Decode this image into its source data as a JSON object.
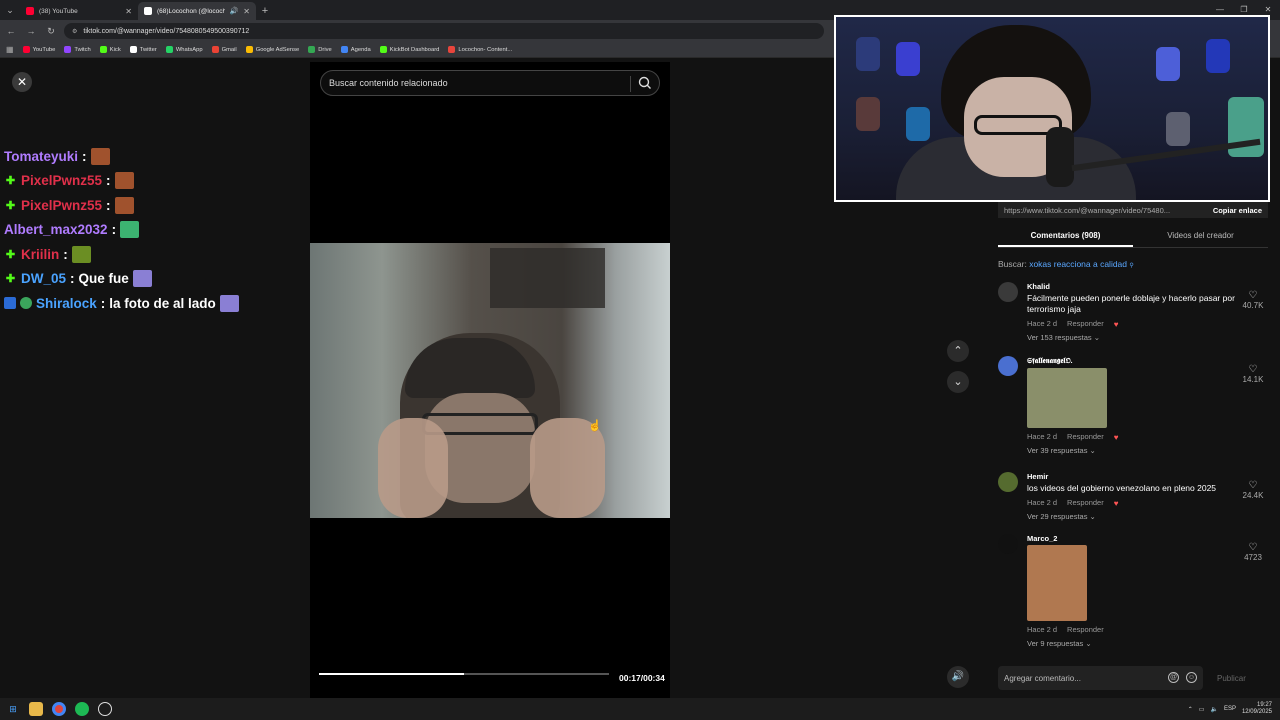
{
  "browser": {
    "tabs": [
      {
        "title": "(38) YouTube",
        "active": false,
        "favicon_color": "#ff0033"
      },
      {
        "title": "(68)Locochon (@locochon...",
        "active": true,
        "favicon_color": "#ffffff"
      }
    ],
    "new_tab_label": "+",
    "url": "tiktok.com/@wannager/video/7548080549500390712",
    "bookmarks": [
      {
        "label": "YouTube",
        "color": "#ff0033"
      },
      {
        "label": "Twitch",
        "color": "#9146ff"
      },
      {
        "label": "Kick",
        "color": "#53fc18"
      },
      {
        "label": "Twitter",
        "color": "#ffffff"
      },
      {
        "label": "WhatsApp",
        "color": "#25d366"
      },
      {
        "label": "Gmail",
        "color": "#ea4335"
      },
      {
        "label": "Google AdSense",
        "color": "#fbbc04"
      },
      {
        "label": "Drive",
        "color": "#34a853"
      },
      {
        "label": "Agenda",
        "color": "#4285f4"
      },
      {
        "label": "KickBot Dashboard",
        "color": "#53fc18"
      },
      {
        "label": "Locochon- Content...",
        "color": "#e8453c"
      }
    ]
  },
  "chat": [
    {
      "user": "Tomateyuki",
      "color": "#b07cff",
      "badge": "none",
      "message": "",
      "emote_color": "#a0522d"
    },
    {
      "user": "PixelPwnz55",
      "color": "#e0304a",
      "badge": "kick",
      "message": "",
      "emote_color": "#a0522d"
    },
    {
      "user": "PixelPwnz55",
      "color": "#e0304a",
      "badge": "kick",
      "message": "",
      "emote_color": "#a0522d"
    },
    {
      "user": "Albert_max2032",
      "color": "#b07cff",
      "badge": "none",
      "message": "",
      "emote_color": "#3cb371"
    },
    {
      "user": "Kriilin",
      "color": "#e0304a",
      "badge": "kick",
      "message": "",
      "emote_color": "#6b8e23"
    },
    {
      "user": "DW_05",
      "color": "#4aa3ff",
      "badge": "kick",
      "message": "Que fue",
      "emote_color": "#8a7fd4"
    },
    {
      "user": "Shiralock",
      "color": "#4aa3ff",
      "badge": "multi",
      "message": "la foto de al lado",
      "emote_color": "#8a7fd4"
    }
  ],
  "video": {
    "search_placeholder": "Buscar contenido relacionado",
    "progress_fraction": 0.5,
    "timecode": "00:17/00:34"
  },
  "side": {
    "share_url": "https://www.tiktok.com/@wannager/video/75480...",
    "copy_label": "Copiar enlace",
    "tabs": [
      "Comentarios (908)",
      "Videos del creador"
    ],
    "search_prefix": "Buscar:",
    "search_query": "xokas reacciona a calidad",
    "comments": [
      {
        "user": "Khalid",
        "text": "Fácilmente pueden ponerle doblaje y hacerlo pasar por terrorismo jaja",
        "age": "Hace 2 d",
        "reply": "Responder",
        "replies": "Ver 153 respuestas",
        "likes": "40.7K",
        "avatar_color": "#3a3a3a",
        "has_image": false
      },
      {
        "user": "𝕾𝖋𝖆𝖑𝖑𝖊𝖓𝖆𝖓𝖌𝖊𝖑𝕺.",
        "text": "",
        "age": "Hace 2 d",
        "reply": "Responder",
        "replies": "Ver 39 respuestas",
        "likes": "14.1K",
        "avatar_color": "#4a6fd0",
        "has_image": true,
        "image_color": "#8a8f6a"
      },
      {
        "user": "Hemir",
        "text": "los videos del gobierno venezolano en pleno 2025",
        "age": "Hace 2 d",
        "reply": "Responder",
        "replies": "Ver 29 respuestas",
        "likes": "24.4K",
        "avatar_color": "#556b2f",
        "has_image": false
      },
      {
        "user": "Marco_2",
        "text": "",
        "age": "Hace 2 d",
        "reply": "Responder",
        "replies": "Ver 9 respuestas",
        "likes": "4723",
        "avatar_color": "#111111",
        "has_image": true,
        "image_color": "#b07850"
      }
    ],
    "composer_placeholder": "Agregar comentario...",
    "publish_label": "Publicar"
  },
  "taskbar": {
    "lang": "ESP",
    "time": "19:27",
    "date": "12/09/2025"
  }
}
